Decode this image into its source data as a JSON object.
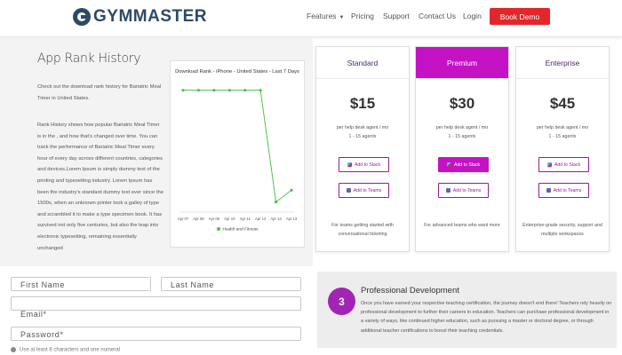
{
  "header": {
    "brand": "GYMMASTER",
    "nav": {
      "features": "Features",
      "pricing": "Pricing",
      "support": "Support",
      "contact": "Contact Us",
      "login": "Login"
    },
    "cta": "Book Demo"
  },
  "rank": {
    "title": "App Rank History",
    "intro": "Check out the download rank history for Bariatric Meal Timer in United States.",
    "body": "Rank History shows how popular Bariatric Meal Timer is in the , and how that's changed over time. You can track the performance of Bariatric Meal Timer every hour of every day across different countries, categories and devices.Lorem Ipsum is simply dummy text of the printing and typesetting industry. Lorem Ipsum has been the industry's standard dummy text ever since the 1500s, when an unknown printer took a galley of type and scrambled it to make a type specimen book. It has survived not only five centuries, but also the leap into electronic typesetting, remaining essentially unchanged"
  },
  "chart_data": {
    "type": "line",
    "title": "Download Rank - iPhone - United States - Last 7 Days",
    "categories": [
      "Apr 07",
      "Apr 08",
      "Apr 09",
      "Apr 10",
      "Apr 11",
      "Apr 12",
      "Apr 13",
      "Apr 13"
    ],
    "series": [
      {
        "name": "Health and Fitness",
        "values": [
          1,
          1,
          1,
          1,
          1,
          1,
          48,
          43
        ]
      }
    ],
    "color": "#4ec24e",
    "ylim": [
      0,
      50
    ],
    "y_inverted": true,
    "legend": "bottom-center"
  },
  "pricing": {
    "plans": [
      {
        "name": "Standard",
        "price": "$15",
        "desc1": "per help desk agent / mo",
        "desc2": "1 - 15 agents",
        "slack": "Add to Slack",
        "teams": "Add to Teams",
        "footer": "For teams getting started with conversational ticketing"
      },
      {
        "name": "Premium",
        "price": "$30",
        "desc1": "per help desk agent / mo",
        "desc2": "1 - 15 agents",
        "slack": "Add to Slack",
        "teams": "Add to Teams",
        "footer": "For advanced teams who want more"
      },
      {
        "name": "Enterprise",
        "price": "$45",
        "desc1": "per help desk agent / mo",
        "desc2": "1 - 15 agents",
        "slack": "Add to Slack",
        "teams": "Add to Teams",
        "footer": "Enterprise-grade security, support and multiple workspaces"
      }
    ],
    "accent": "#c512c5"
  },
  "form": {
    "first_name": "First Name",
    "last_name": "Last Name",
    "email": "Email*",
    "password": "Password*",
    "hint": "Use at least 8 characters and one numeral"
  },
  "pd": {
    "number": "3",
    "title": "Professional Development",
    "text": "Once you have earned your respective teaching certification, the journey doesn't end there! Teachers rely heavily on professional development to further their careers in education. Teachers can purchase professional development in a variety of ways, like continued higher education, such as pursuing a master or doctoral degree, or through additional teacher certifications to boost their teaching credentials."
  }
}
